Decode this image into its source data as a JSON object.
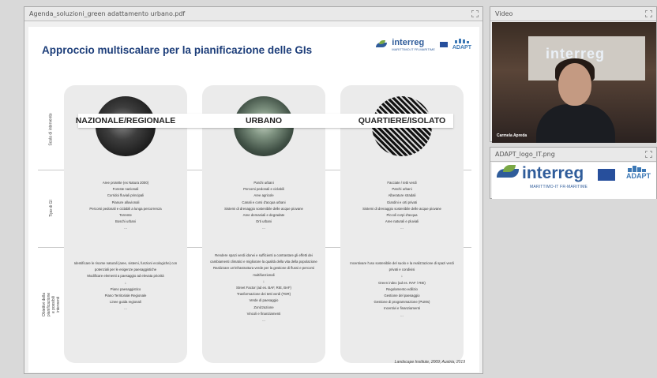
{
  "doc_window": {
    "title": "Agenda_soluzioni_green adattamento urbano.pdf",
    "slide": {
      "title": "Approccio multiscalare per la pianificazione delle GIs",
      "logo_text": "interreg",
      "logo_sub": "MARITTIMO-IT FR-MARITIME",
      "adapt": "ADAPT",
      "row_labels": [
        "Scala di intervento",
        "Tipo di GI",
        "Obiettivi della pianificazione e possibili interventi"
      ],
      "columns": [
        {
          "label": "NAZIONALE/REGIONALE",
          "types": [
            "Aree protette (ex Natura 2000)",
            "Foreste nazionali",
            "Corridoi fluviali principali",
            "Pianure alluvionali",
            "Percorsi pedonali e ciclabili a lunga percorrenza",
            "Torrente",
            "Boschi urbani",
            "..."
          ],
          "objectives": [
            "Identificare le risorse naturali (aree, sistemi, funzioni ecologiche) con potenziali per le esigenze paesaggistiche",
            "Modificare elementi a paesaggio ad elevata priorità",
            "↓",
            "Piano paesaggistico",
            "Piano Territoriale Regionale",
            "Linee guida regionali",
            "..."
          ]
        },
        {
          "label": "URBANO",
          "types": [
            "Parchi urbani",
            "Percorsi pedonali e ciclabili",
            "Aree agricole",
            "Canali e corsi d'acqua urbani",
            "Sistemi di drenaggio sostenibile delle acque piovane",
            "Aree demaniali e degradate",
            "Orti urbani",
            "..."
          ],
          "objectives": [
            "Rendere spazi verdi idonei e sufficienti a contrastare gli effetti dei cambiamenti climatici e migliorare la qualità della vita della popolazione",
            "Realizzare un'infrastruttura verde per la gestione di flussi e percorsi multifunzionali",
            "↓",
            "Street Factor (ad es. BAF, RIE, BAF)",
            "Trasformazione dei tetti verdi (TDR)",
            "Verde di paesaggio",
            "Zonizzazione",
            "Vincoli e finanziamenti",
            "..."
          ]
        },
        {
          "label": "QUARTIERE/ISOLATO",
          "types": [
            "Facciate / tetti verdi",
            "Parchi urbani",
            "Alberature stradali",
            "Giardini e orti privati",
            "Sistemi di drenaggio sostenibile delle acque piovane",
            "Piccoli corpi d'acqua",
            "Aree naturali e pluviali",
            "..."
          ],
          "objectives": [
            "Incentivare l'uso sostenibile del suolo e la realizzazione di spazi verdi privati e condivisi",
            "↓",
            "Green index (ad es. RAF / RIE)",
            "Regolamento edilizio",
            "Gestione del paesaggio",
            "Gestione di programmazione (PUMs)",
            "Incentivi e finanziamenti",
            "..."
          ]
        }
      ],
      "footer_note": "Landscape Institute, 2009; Austria, 2019"
    }
  },
  "video_window": {
    "title": "Video",
    "screen_text": "interreg",
    "name_tag": "Carmela Apreda"
  },
  "logo_window": {
    "title": "ADAPT_logo_IT.png",
    "logo_text": "interreg",
    "logo_sub": "MARITTIMO-IT FR-MARITIME",
    "adapt": "ADAPT"
  }
}
